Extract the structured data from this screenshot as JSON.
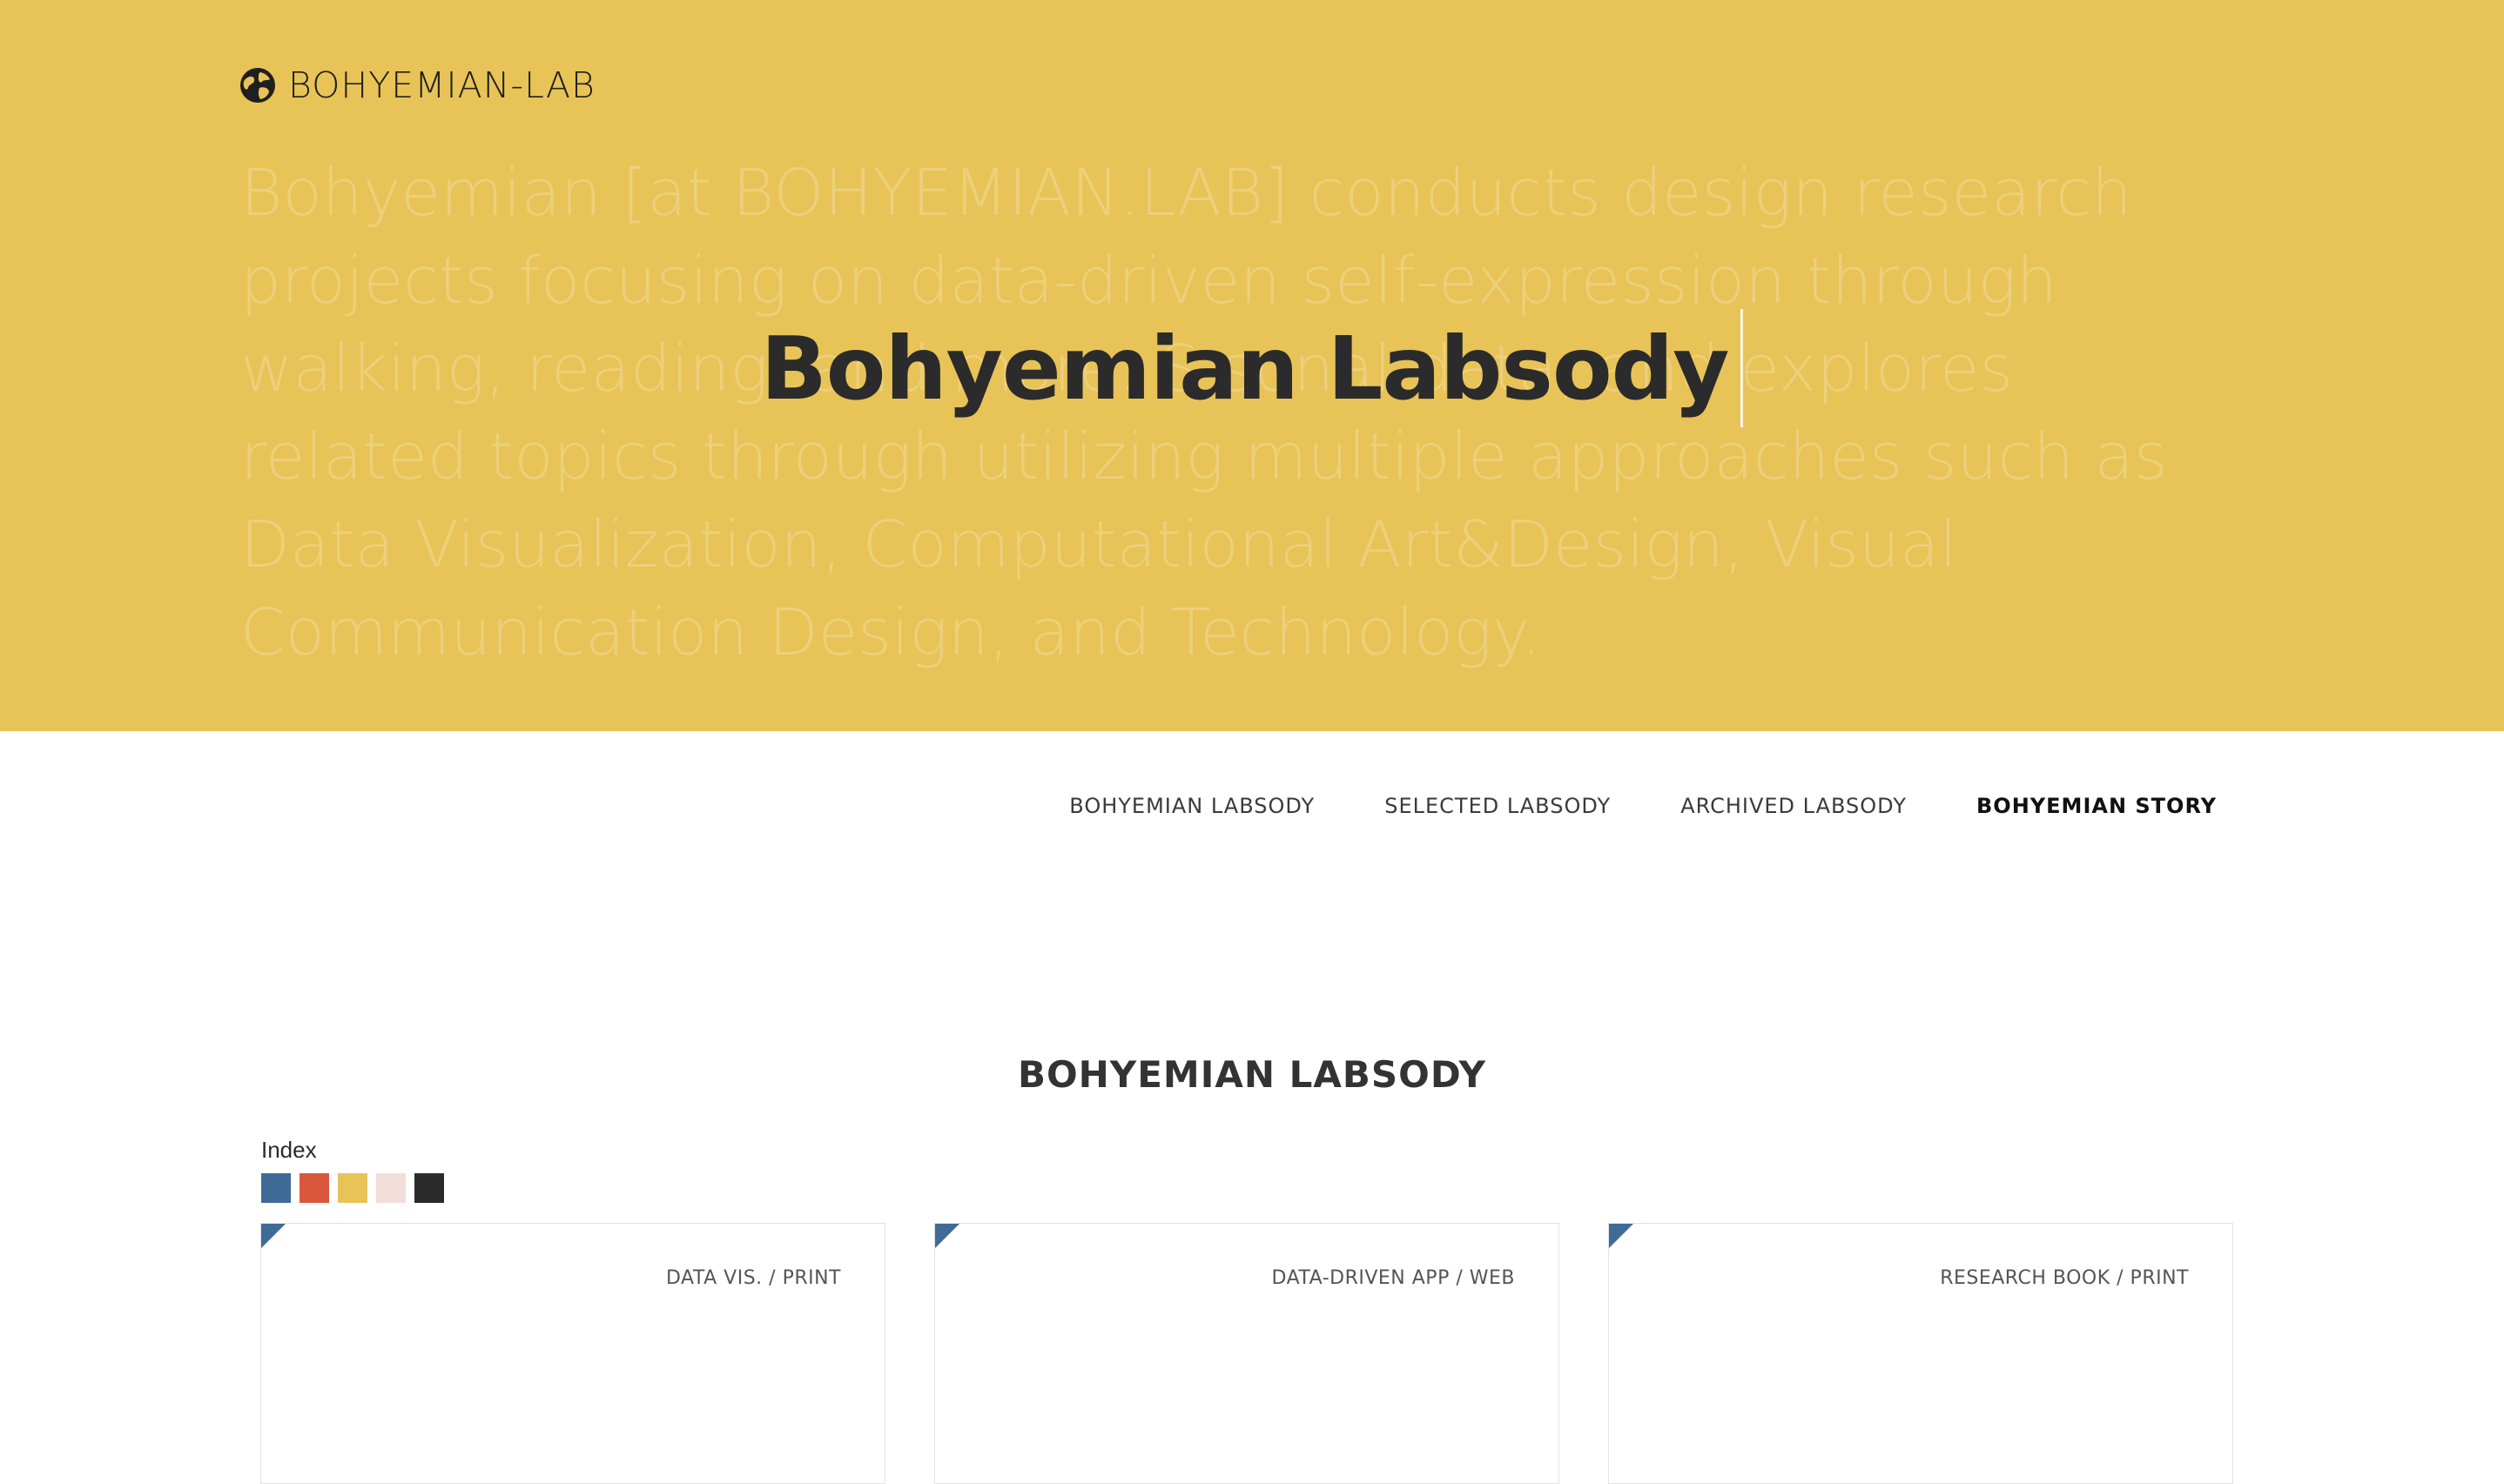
{
  "header": {
    "brand_icon": "globe-icon",
    "brand_name": "BOHYEMIAN-LAB",
    "background_color": "#e8c357"
  },
  "hero": {
    "background_text": "Bohyemian [at BOHYEMIAN.LAB] conducts design research projects focusing on data-driven self-expression through walking, reading, and more. S                              sonal data, and explores related topics through utilizing multiple approaches such as Data Visualization, Computational Art&Design, Visual Communication Design, and Technology.",
    "title": "Bohyemian Labsody"
  },
  "nav": {
    "items": [
      {
        "label": "BOHYEMIAN LABSODY"
      },
      {
        "label": "SELECTED LABSODY"
      },
      {
        "label": "ARCHIVED LABSODY"
      },
      {
        "label": "BOHYEMIAN STORY"
      }
    ],
    "active_index": 3
  },
  "section": {
    "title": "BOHYEMIAN LABSODY",
    "index_label": "Index",
    "swatches": [
      {
        "color": "#3f6b98"
      },
      {
        "color": "#d9583d"
      },
      {
        "color": "#e8c357"
      },
      {
        "color": "#f2ddd9"
      },
      {
        "color": "#2b2b2b"
      }
    ]
  },
  "cards": [
    {
      "category": "DATA VIS. / PRINT",
      "accent": "#3f6b98"
    },
    {
      "category": "DATA-DRIVEN APP / WEB",
      "accent": "#3f6b98"
    },
    {
      "category": "RESEARCH BOOK / PRINT",
      "accent": "#3f6b98"
    }
  ]
}
